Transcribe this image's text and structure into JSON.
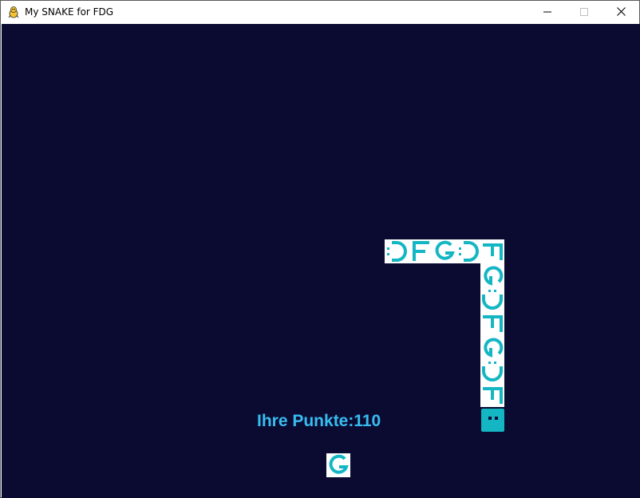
{
  "window": {
    "title": "My SNAKE for FDG",
    "app_icon": "pygame-snake-icon",
    "controls": [
      "minimize-icon",
      "maximize-icon",
      "close-icon"
    ]
  },
  "game": {
    "background_color": "#0b0b32",
    "score": {
      "text": "Ihre Punkte:110",
      "label": "Ihre Punkte:",
      "value": 110,
      "color": "#38bdf0"
    },
    "snake": {
      "head_color": "#14b6c4",
      "segment_letters": [
        "D",
        "F",
        "G",
        "D",
        "F",
        "G",
        "D",
        "F",
        "G",
        "D",
        "F"
      ],
      "segment_color": "#14b6c4"
    },
    "food": {
      "letter": "G"
    }
  }
}
